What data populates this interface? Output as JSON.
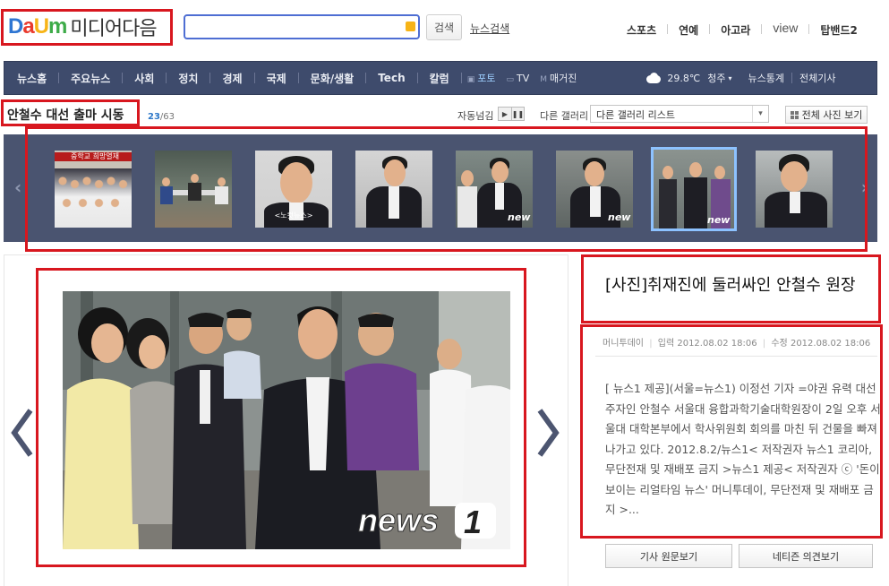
{
  "header": {
    "logo_media": "미디어다음",
    "search_placeholder": "",
    "search_button": "검색",
    "news_search": "뉴스검색",
    "top_links": [
      "스포츠",
      "연예",
      "아고라",
      "view",
      "탑밴드2"
    ]
  },
  "nav": {
    "items": [
      "뉴스홈",
      "주요뉴스",
      "사회",
      "정치",
      "경제",
      "국제",
      "문화/생활",
      "Tech",
      "칼럼"
    ],
    "media_items": [
      "포토",
      "TV",
      "매거진"
    ],
    "weather_temp": "29.8℃",
    "weather_city": "청주",
    "right_links": [
      "뉴스통계",
      "전체기사"
    ]
  },
  "gallery": {
    "title": "안철수 대선 출마 시동",
    "current": "23",
    "total": "/63",
    "autoplay_label": "자동넘김",
    "other_gallery_label": "다른 갤러리",
    "select_value": "다른 갤러리 리스트",
    "view_all_button": "전체 사진 보기",
    "thumb_banner_text": "중학교 희망열재",
    "thumb_caption": "<노컷뉴스>",
    "active_index": 6
  },
  "article": {
    "title": "[사진]취재진에 둘러싸인 안철수 원장",
    "source": "머니투데이",
    "input_label": "입력",
    "input_time": "2012.08.02 18:06",
    "edit_label": "수정",
    "edit_time": "2012.08.02 18:06",
    "body": "[ 뉴스1 제공](서울=뉴스1) 이정선 기자 =야권 유력 대선주자인 안철수 서울대 융합과학기술대학원장이 2일 오후 서울대 대학본부에서 학사위원회 회의를 마친 뒤 건물을 빠져나가고 있다. 2012.8.2/뉴스1< 저작권자 뉴스1 코리아, 무단전재 및 재배포 금지 >뉴스1 제공< 저작권자 ⓒ '돈이 보이는 리얼타임 뉴스' 머니투데이, 무단전재 및 재배포 금지 >...",
    "btn_original": "기사 원문보기",
    "btn_opinion": "네티즌 의견보기"
  },
  "colors": {
    "nav_bg": "#3e4b6c",
    "strip_bg": "#4a5470",
    "highlight_box": "#d8171f",
    "active_thumb": "#8dc2ff"
  }
}
